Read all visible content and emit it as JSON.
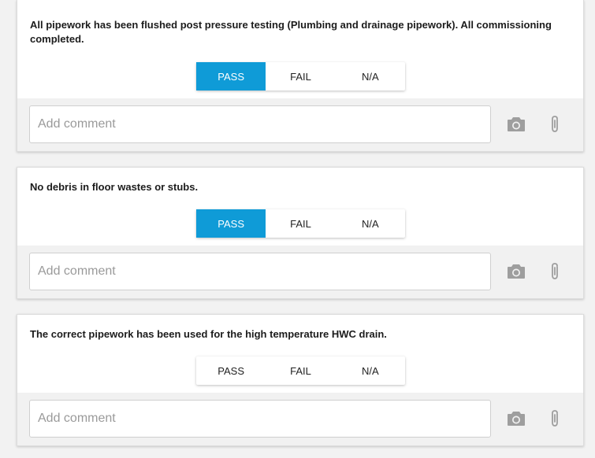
{
  "colors": {
    "accent": "#0f9bd7",
    "icon": "#9e9e9e"
  },
  "items": [
    {
      "question": "All pipework has been flushed post pressure testing (Plumbing and drainage pipework). All commissioning completed.",
      "options": [
        "PASS",
        "FAIL",
        "N/A"
      ],
      "selected": "PASS",
      "comment_placeholder": "Add comment",
      "comment_value": "",
      "icons": [
        "camera-icon",
        "paperclip-icon"
      ]
    },
    {
      "question": "No debris in floor wastes or stubs.",
      "options": [
        "PASS",
        "FAIL",
        "N/A"
      ],
      "selected": "PASS",
      "comment_placeholder": "Add comment",
      "comment_value": "",
      "icons": [
        "camera-icon",
        "paperclip-icon"
      ]
    },
    {
      "question": "The correct pipework has been used for the high temperature HWC drain.",
      "options": [
        "PASS",
        "FAIL",
        "N/A"
      ],
      "selected": "",
      "comment_placeholder": "Add comment",
      "comment_value": "",
      "icons": [
        "camera-icon",
        "paperclip-icon"
      ]
    }
  ]
}
